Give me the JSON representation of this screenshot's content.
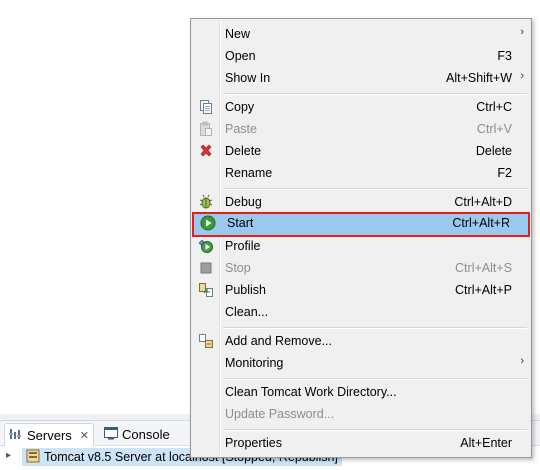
{
  "menu": {
    "items": [
      {
        "label": "New",
        "shortcut": "",
        "submenu": true,
        "icon": "none",
        "disabled": false
      },
      {
        "label": "Open",
        "shortcut": "F3",
        "submenu": false,
        "icon": "none",
        "disabled": false
      },
      {
        "label": "Show In",
        "shortcut": "Alt+Shift+W",
        "submenu": true,
        "icon": "none",
        "disabled": false
      },
      {
        "label": "Copy",
        "shortcut": "Ctrl+C",
        "submenu": false,
        "icon": "copy-icon",
        "disabled": false
      },
      {
        "label": "Paste",
        "shortcut": "Ctrl+V",
        "submenu": false,
        "icon": "paste-icon",
        "disabled": true
      },
      {
        "label": "Delete",
        "shortcut": "Delete",
        "submenu": false,
        "icon": "delete-icon",
        "disabled": false
      },
      {
        "label": "Rename",
        "shortcut": "F2",
        "submenu": false,
        "icon": "none",
        "disabled": false
      },
      {
        "label": "Debug",
        "shortcut": "Ctrl+Alt+D",
        "submenu": false,
        "icon": "debug-icon",
        "disabled": false
      },
      {
        "label": "Start",
        "shortcut": "Ctrl+Alt+R",
        "submenu": false,
        "icon": "start-icon",
        "disabled": false,
        "highlighted": true
      },
      {
        "label": "Profile",
        "shortcut": "",
        "submenu": false,
        "icon": "profile-icon",
        "disabled": false
      },
      {
        "label": "Stop",
        "shortcut": "Ctrl+Alt+S",
        "submenu": false,
        "icon": "stop-icon",
        "disabled": true
      },
      {
        "label": "Publish",
        "shortcut": "Ctrl+Alt+P",
        "submenu": false,
        "icon": "publish-icon",
        "disabled": false
      },
      {
        "label": "Clean...",
        "shortcut": "",
        "submenu": false,
        "icon": "none",
        "disabled": false
      },
      {
        "label": "Add and Remove...",
        "shortcut": "",
        "submenu": false,
        "icon": "add-remove-icon",
        "disabled": false
      },
      {
        "label": "Monitoring",
        "shortcut": "",
        "submenu": true,
        "icon": "none",
        "disabled": false
      },
      {
        "label": "Clean Tomcat Work Directory...",
        "shortcut": "",
        "submenu": false,
        "icon": "none",
        "disabled": false
      },
      {
        "label": "Update Password...",
        "shortcut": "",
        "submenu": false,
        "icon": "none",
        "disabled": true
      },
      {
        "label": "Properties",
        "shortcut": "Alt+Enter",
        "submenu": false,
        "icon": "none",
        "disabled": false
      }
    ],
    "submenu_arrow": "›"
  },
  "tabs": {
    "servers_label": "Servers",
    "servers_close": "✕",
    "console_label": "Console"
  },
  "servers": {
    "row_label": "Tomcat v8.5 Server at localhost  [Stopped, Republish]"
  },
  "colors": {
    "highlight_bg": "#99c9ef",
    "highlight_border": "#e02020",
    "menu_bg": "#f0f0f0"
  }
}
